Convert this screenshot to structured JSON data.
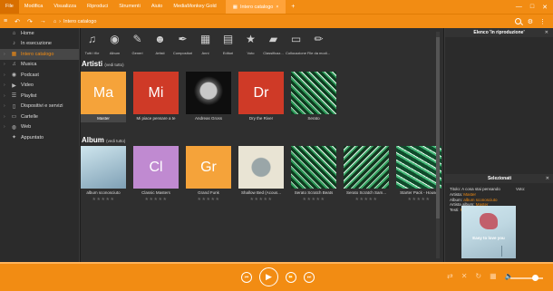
{
  "menu": {
    "items": [
      "File",
      "Modifica",
      "Visualizza",
      "Riproduci",
      "Strumenti",
      "Aiuto",
      "MediaMonkey Gold"
    ],
    "tab_label": "Intero catalogo",
    "tab_close": "×",
    "add_tab": "+",
    "controls": {
      "minimize": "—",
      "maximize": "□",
      "close": "✕"
    }
  },
  "nav": {
    "back": "↶",
    "forward": "↷",
    "menu": "≡",
    "arrow": "→",
    "home_glyph": "⌂",
    "crumb_sep": "›",
    "crumb": "Intero catalogo",
    "right_icons": [
      "⚙",
      "⋮"
    ]
  },
  "sidebar": {
    "items": [
      {
        "label": "Home",
        "chev": "",
        "icon": "⌂"
      },
      {
        "label": "In esecuzione",
        "chev": "",
        "icon": "♪"
      },
      {
        "label": "Intero catalogo",
        "chev": "›",
        "icon": "▦"
      },
      {
        "label": "Musica",
        "chev": "›",
        "icon": "♫"
      },
      {
        "label": "Podcast",
        "chev": "›",
        "icon": "◉"
      },
      {
        "label": "Video",
        "chev": "›",
        "icon": "▶"
      },
      {
        "label": "Playlist",
        "chev": "›",
        "icon": "☰"
      },
      {
        "label": "Dispositivi e servizi",
        "chev": "›",
        "icon": "▯"
      },
      {
        "label": "Cartelle",
        "chev": "›",
        "icon": "▭"
      },
      {
        "label": "Web",
        "chev": "›",
        "icon": "◍"
      },
      {
        "label": "Appuntato",
        "chev": "",
        "icon": "✦"
      }
    ]
  },
  "categories": [
    {
      "label": "Tutti i file",
      "glyph": "♫"
    },
    {
      "label": "Album",
      "glyph": "◉"
    },
    {
      "label": "Generi",
      "glyph": "✎"
    },
    {
      "label": "Artisti",
      "glyph": "☻"
    },
    {
      "label": "Compositori",
      "glyph": "✒"
    },
    {
      "label": "Anni",
      "glyph": "▦"
    },
    {
      "label": "Editori",
      "glyph": "▤"
    },
    {
      "label": "Voto",
      "glyph": "★"
    },
    {
      "label": "Classificaz...",
      "glyph": "▰"
    },
    {
      "label": "Collocazione",
      "glyph": "▭"
    },
    {
      "label": "File da modi...",
      "glyph": "✏"
    }
  ],
  "artists": {
    "title": "Artisti",
    "link": "(vedi tutto)",
    "items": [
      {
        "label": "Master",
        "initials": "Ma",
        "color": "#f5a33a"
      },
      {
        "label": "Mi piace pensare a te",
        "initials": "Mi",
        "color": "#cf3a27"
      },
      {
        "label": "Andreas Gross",
        "initials": "",
        "color": "#0e0e0e"
      },
      {
        "label": "Dry the River",
        "initials": "Dr",
        "color": "#cf3a27"
      },
      {
        "label": "Serato",
        "initials": "",
        "color": "#0d3b1f"
      }
    ]
  },
  "albums": {
    "title": "Album",
    "link": "(vedi tutto)",
    "stars": "★★★★★",
    "items": [
      {
        "label": "album sconosciuto",
        "initials": "",
        "color": "#7fa0b5"
      },
      {
        "label": "Classic Masters",
        "initials": "Cl",
        "color": "#c08ad1"
      },
      {
        "label": "Grand Funk",
        "initials": "Gr",
        "color": "#f5a33a"
      },
      {
        "label": "Shallow Bed (Acous...",
        "initials": "",
        "color": "#e9e4d4"
      },
      {
        "label": "Serato Scratch Beats",
        "initials": "",
        "color": "#0d3b1f"
      },
      {
        "label": "Serato Scratch Sam...",
        "initials": "",
        "color": "#12361f"
      },
      {
        "label": "Starter Pack - House",
        "initials": "",
        "color": "#0f4a2b"
      }
    ]
  },
  "right_panel": {
    "playlist_title": "Elenco 'In riproduzione'",
    "selected_title": "Selezionati",
    "close": "✕",
    "volume_label": "Voto:",
    "info": [
      {
        "k": "Titolo:",
        "v": "A cosa stai pensando"
      },
      {
        "k": "Artista:",
        "v": "Master"
      },
      {
        "k": "Album:",
        "v": "album sconosciuto"
      },
      {
        "k": "Artista album:",
        "v": "Master"
      },
      {
        "k": "Testi:",
        "v": "Ricerca"
      }
    ],
    "cover_text": "Easy to love you"
  },
  "player": {
    "prev": "⏮",
    "rewind": "⏪",
    "play": "▶",
    "forward": "⏩",
    "next": "⏭",
    "right_icons": [
      "⇄",
      "✕",
      "↻",
      "▦",
      "🔈"
    ],
    "volume_level": 0.7
  },
  "colors": {
    "accent": "#f28c13",
    "panel": "#2b2b2b",
    "content": "#2f2f2f"
  }
}
